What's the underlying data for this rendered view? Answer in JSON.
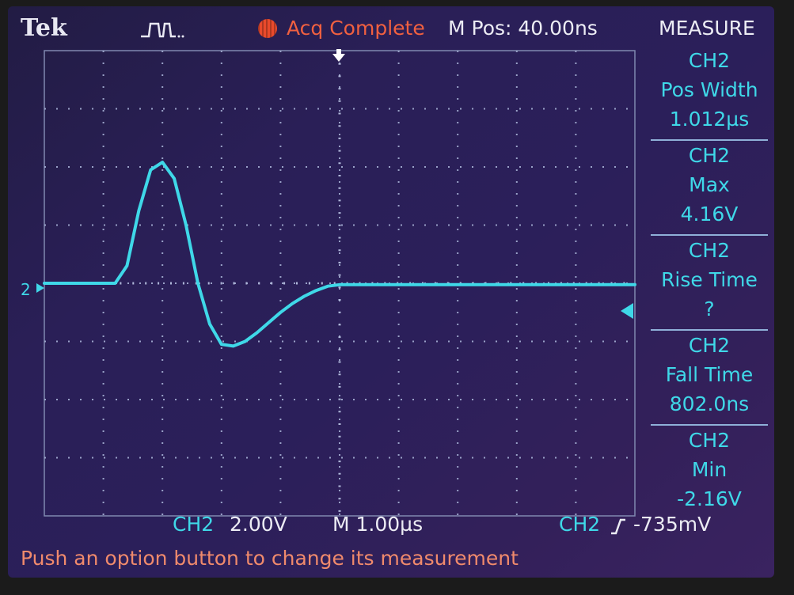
{
  "header": {
    "brand": "Tek",
    "acq_status": "Acq Complete",
    "m_pos": "M Pos: 40.00ns",
    "menu_title": "MEASURE"
  },
  "measurements": [
    {
      "channel": "CH2",
      "name": "Pos Width",
      "value": "1.012µs"
    },
    {
      "channel": "CH2",
      "name": "Max",
      "value": "4.16V"
    },
    {
      "channel": "CH2",
      "name": "Rise Time",
      "value": "?"
    },
    {
      "channel": "CH2",
      "name": "Fall Time",
      "value": "802.0ns"
    },
    {
      "channel": "CH2",
      "name": "Min",
      "value": "-2.16V"
    }
  ],
  "bottom": {
    "channel_scale_ch": "CH2",
    "channel_scale": "2.00V",
    "timebase": "M 1.00µs",
    "trigger_ch": "CH2",
    "trigger_level": "-735mV"
  },
  "ground_marker": "2",
  "status_message": "Push an option button to change its measurement",
  "colors": {
    "trace": "#3fd8e8",
    "acq_status": "#f06040",
    "message": "#f08a6c",
    "screen_bg": "#2b1f5a",
    "text": "#ececf4"
  },
  "chart_data": {
    "type": "line",
    "x_unit": "µs",
    "y_unit": "V",
    "xlim": [
      -5,
      5
    ],
    "ylim": [
      -8,
      8
    ],
    "grid": true,
    "series": [
      {
        "x": [
          -5.0,
          -3.8,
          -3.6,
          -3.4,
          -3.2,
          -3.0,
          -2.8,
          -2.6,
          -2.4,
          -2.2,
          -2.0,
          -1.8,
          -1.6,
          -1.4,
          -1.2,
          -1.0,
          -0.8,
          -0.6,
          -0.4,
          -0.2,
          0.0,
          1.0,
          2.0,
          3.0,
          4.0,
          5.0
        ],
        "y": [
          0.0,
          0.0,
          0.6,
          2.5,
          3.9,
          4.16,
          3.6,
          2.0,
          0.0,
          -1.4,
          -2.1,
          -2.16,
          -2.0,
          -1.7,
          -1.35,
          -1.0,
          -0.7,
          -0.45,
          -0.25,
          -0.1,
          -0.05,
          -0.05,
          -0.05,
          -0.05,
          -0.05,
          -0.05
        ]
      }
    ]
  }
}
